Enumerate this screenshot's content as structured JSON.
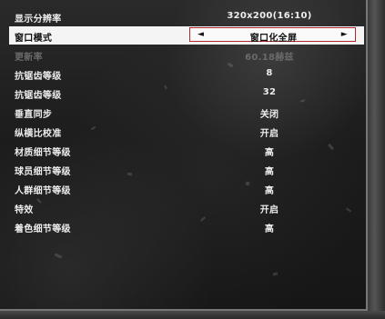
{
  "settings": [
    {
      "label": "显示分辨率",
      "value": "320x200(16:10)"
    },
    {
      "label": "窗口模式",
      "value": "窗口化全屏"
    },
    {
      "label": "更新率",
      "value": "60.18赫兹"
    },
    {
      "label": "抗锯齿等级",
      "value": "8"
    },
    {
      "label": "抗锯齿等级",
      "value": "32"
    },
    {
      "label": "垂直同步",
      "value": "关闭"
    },
    {
      "label": "纵横比校准",
      "value": "开启"
    },
    {
      "label": "材质细节等级",
      "value": "高"
    },
    {
      "label": "球员细节等级",
      "value": "高"
    },
    {
      "label": "人群细节等级",
      "value": "高"
    },
    {
      "label": "特效",
      "value": "开启"
    },
    {
      "label": "着色细节等级",
      "value": "高"
    }
  ],
  "selector": {
    "left_arrow": "◄",
    "right_arrow": "►"
  }
}
